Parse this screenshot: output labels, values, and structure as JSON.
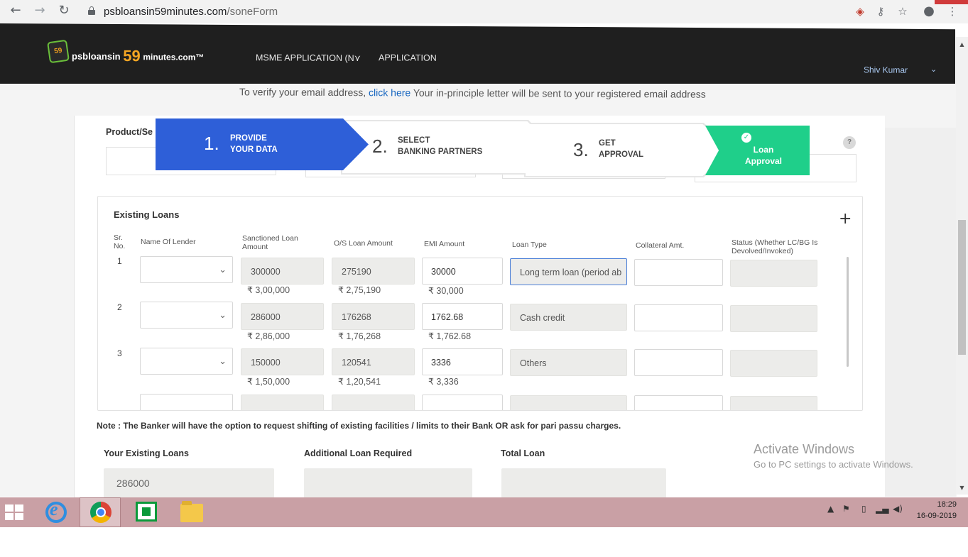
{
  "browser": {
    "url_host": "psbloansin59minutes.com",
    "url_path": "/soneForm"
  },
  "site": {
    "logo_badge": "59",
    "logo_pre": "psbloansin",
    "logo_num": "59",
    "logo_post": "minutes.com",
    "logo_tm": "™",
    "nav": [
      "MSME APPLICATION (N",
      "APPLICATION"
    ],
    "user_name": "Shiv Kumar"
  },
  "verify": {
    "prefix": "To verify your email address,",
    "link": "click here",
    "suffix": "Your in-principle letter will be sent to your registered email address"
  },
  "product_label": "Product/Se",
  "stepper": {
    "steps": [
      {
        "num": "1.",
        "line1": "PROVIDE",
        "line2": "YOUR DATA"
      },
      {
        "num": "2.",
        "line1": "SELECT",
        "line2": "BANKING PARTNERS"
      },
      {
        "num": "3.",
        "line1": "GET",
        "line2": "APPROVAL"
      },
      {
        "num": "",
        "line1": "Loan",
        "line2": "Approval"
      }
    ],
    "help": "?"
  },
  "existing_loans": {
    "title": "Existing Loans",
    "columns": {
      "sr": "Sr.\nNo.",
      "lender": "Name Of Lender",
      "sanctioned": "Sanctioned Loan Amount",
      "os": "O/S Loan Amount",
      "emi": "EMI Amount",
      "type": "Loan Type",
      "collateral": "Collateral Amt.",
      "status": "Status (Whether LC/BG Is Devolved/Invoked)"
    },
    "rows": [
      {
        "sr": "1",
        "sanctioned": "300000",
        "sanctioned_fmt": "₹ 3,00,000",
        "os": "275190",
        "os_fmt": "₹ 2,75,190",
        "emi": "30000",
        "emi_fmt": "₹ 30,000",
        "type": "Long term loan (period ab"
      },
      {
        "sr": "2",
        "sanctioned": "286000",
        "sanctioned_fmt": "₹ 2,86,000",
        "os": "176268",
        "os_fmt": "₹ 1,76,268",
        "emi": "1762.68",
        "emi_fmt": "₹ 1,762.68",
        "type": "Cash credit"
      },
      {
        "sr": "3",
        "sanctioned": "150000",
        "sanctioned_fmt": "₹ 1,50,000",
        "os": "120541",
        "os_fmt": "₹ 1,20,541",
        "emi": "3336",
        "emi_fmt": "₹ 3,336",
        "type": "Others"
      }
    ]
  },
  "note": "Note : The Banker will have the option to request shifting of existing facilities / limits to their Bank OR ask for pari passu charges.",
  "summary": {
    "existing_label": "Your Existing Loans",
    "existing_value": "286000",
    "additional_label": "Additional Loan Required",
    "total_label": "Total Loan"
  },
  "watermark": {
    "title": "Activate Windows",
    "sub": "Go to PC settings to activate Windows."
  },
  "taskbar": {
    "time": "18:29",
    "date": "16-09-2019"
  }
}
